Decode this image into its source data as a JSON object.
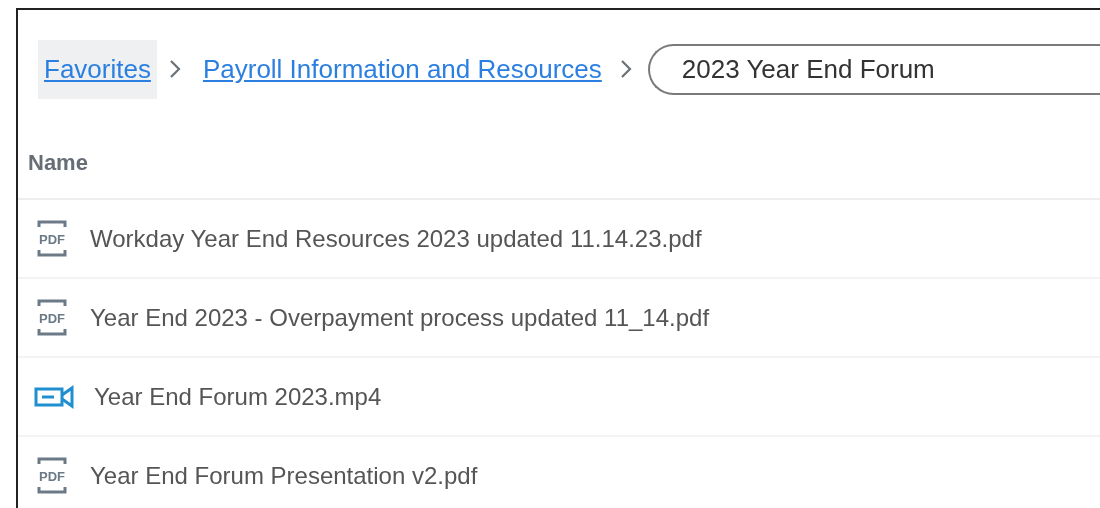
{
  "breadcrumb": [
    {
      "label": "Favorites",
      "kind": "link",
      "hovered": true
    },
    {
      "label": "Payroll Information and Resources",
      "kind": "link",
      "hovered": false
    },
    {
      "label": "2023 Year End Forum",
      "kind": "current"
    }
  ],
  "table": {
    "columns": [
      "Name"
    ],
    "rows": [
      {
        "name": "Workday Year End Resources 2023 updated 11.14.23.pdf",
        "kind": "pdf",
        "icon_text": "PDF"
      },
      {
        "name": "Year End 2023 - Overpayment process updated 11_14.pdf",
        "kind": "pdf",
        "icon_text": "PDF"
      },
      {
        "name": "Year End Forum 2023.mp4",
        "kind": "video"
      },
      {
        "name": "Year End Forum Presentation v2.pdf",
        "kind": "pdf",
        "icon_text": "PDF"
      }
    ]
  }
}
